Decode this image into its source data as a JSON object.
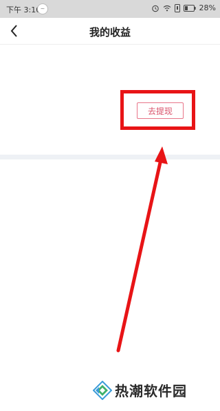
{
  "status_bar": {
    "time": "下午 3:10",
    "indicator": "~",
    "battery": "28%"
  },
  "nav": {
    "title": "我的收益"
  },
  "earnings": {
    "withdraw_label": "去提现"
  },
  "annotation": {
    "highlight_color": "#e81416"
  },
  "watermark": {
    "text": "热潮软件园"
  }
}
